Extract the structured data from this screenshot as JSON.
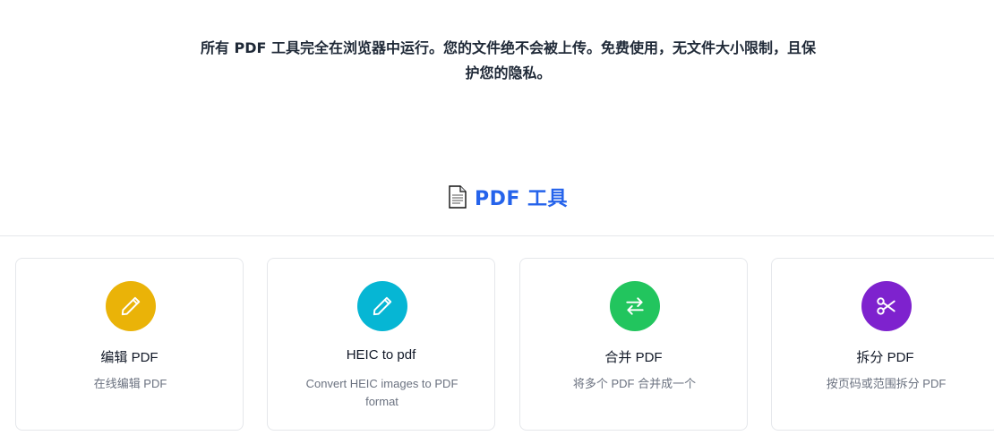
{
  "intro": {
    "line1": "所有 PDF 工具完全在浏览器中运行。您的文件绝不会被上传。免费使用，无文件大小限制，且保",
    "line2": "护您的隐私。"
  },
  "section": {
    "icon": "document-icon",
    "title": "PDF 工具"
  },
  "tools": [
    {
      "title": "编辑 PDF",
      "description": "在线编辑 PDF",
      "icon": "pencil-icon",
      "color": "#eab308"
    },
    {
      "title": "HEIC to pdf",
      "description": "Convert HEIC images to PDF format",
      "icon": "pencil-icon",
      "color": "#06b6d4"
    },
    {
      "title": "合并 PDF",
      "description": "将多个 PDF 合并成一个",
      "icon": "arrows-swap-icon",
      "color": "#22c55e"
    },
    {
      "title": "拆分 PDF",
      "description": "按页码或范围拆分 PDF",
      "icon": "scissors-icon",
      "color": "#7e22ce"
    }
  ]
}
